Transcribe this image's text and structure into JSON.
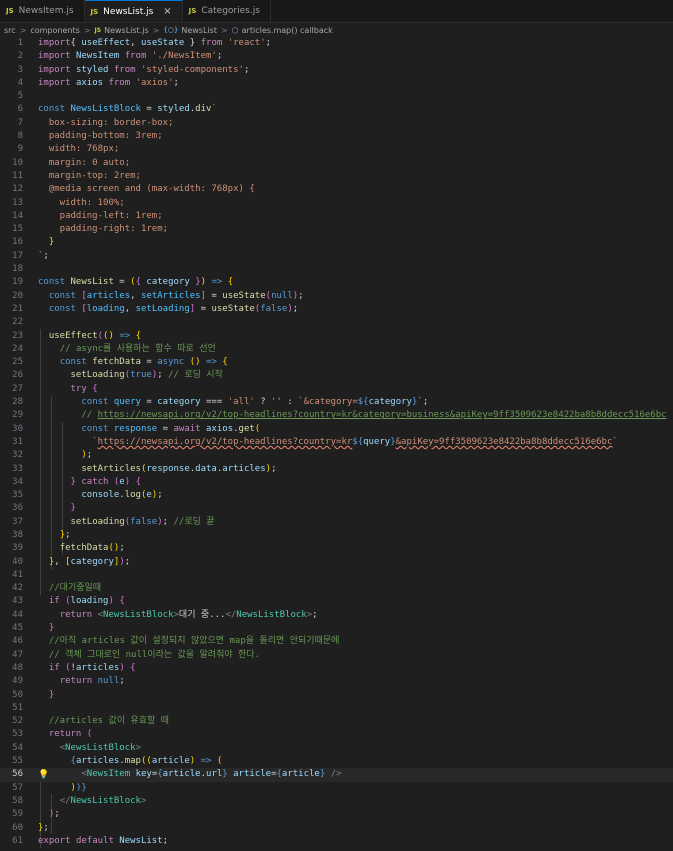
{
  "tabs": [
    {
      "badge": "JS",
      "label": "NewsItem.js",
      "active": false
    },
    {
      "badge": "JS",
      "label": "NewsList.js",
      "active": true,
      "close": "×"
    },
    {
      "badge": "JS",
      "label": "Categories.js",
      "active": false
    }
  ],
  "breadcrumb": {
    "items": [
      "src",
      "components",
      "NewsList.js",
      "NewsList",
      "articles.map() callback"
    ],
    "separator": ">",
    "file_badge": "JS",
    "symbol_glyph": "{○}",
    "function_glyph": "⬡"
  },
  "editor": {
    "current_line": 56,
    "lines": [
      [
        [
          "k",
          "import"
        ],
        [
          "",
          "{ "
        ],
        [
          "v",
          "useEffect"
        ],
        [
          "",
          ", "
        ],
        [
          "v",
          "useState"
        ],
        [
          "",
          " } "
        ],
        [
          "k",
          "from"
        ],
        [
          "",
          " "
        ],
        [
          "s",
          "'react'"
        ],
        [
          "",
          ";"
        ]
      ],
      [
        [
          "k",
          "import"
        ],
        [
          "",
          " "
        ],
        [
          "v",
          "NewsItem"
        ],
        [
          "",
          " "
        ],
        [
          "k",
          "from"
        ],
        [
          "",
          " "
        ],
        [
          "s",
          "'./NewsItem'"
        ],
        [
          "",
          ";"
        ]
      ],
      [
        [
          "k",
          "import"
        ],
        [
          "",
          " "
        ],
        [
          "v",
          "styled"
        ],
        [
          "",
          " "
        ],
        [
          "k",
          "from"
        ],
        [
          "",
          " "
        ],
        [
          "s",
          "'styled-components'"
        ],
        [
          "",
          ";"
        ]
      ],
      [
        [
          "k",
          "import"
        ],
        [
          "",
          " "
        ],
        [
          "v",
          "axios"
        ],
        [
          "",
          " "
        ],
        [
          "k",
          "from"
        ],
        [
          "",
          " "
        ],
        [
          "s",
          "'axios'"
        ],
        [
          "",
          ";"
        ]
      ],
      [],
      [
        [
          "b",
          "const"
        ],
        [
          "",
          " "
        ],
        [
          "c",
          "NewsListBlock"
        ],
        [
          "",
          " = "
        ],
        [
          "v",
          "styled"
        ],
        [
          "",
          "."
        ],
        [
          "f",
          "div"
        ],
        [
          "s",
          "`"
        ]
      ],
      [
        [
          "s",
          "  box-sizing: border-box;"
        ]
      ],
      [
        [
          "s",
          "  padding-bottom: 3rem;"
        ]
      ],
      [
        [
          "s",
          "  width: 768px;"
        ]
      ],
      [
        [
          "s",
          "  margin: 0 auto;"
        ]
      ],
      [
        [
          "s",
          "  margin-top: 2rem;"
        ]
      ],
      [
        [
          "s",
          "  @media screen and (max-width: 768px) {"
        ]
      ],
      [
        [
          "s",
          "    width: 100%;"
        ]
      ],
      [
        [
          "s",
          "    padding-left: 1rem;"
        ]
      ],
      [
        [
          "s",
          "    padding-right: 1rem;"
        ]
      ],
      [
        [
          "s",
          "  "
        ],
        [
          "y",
          "}"
        ]
      ],
      [
        [
          "s",
          "`"
        ],
        [
          "",
          ";"
        ]
      ],
      [],
      [
        [
          "b",
          "const"
        ],
        [
          "",
          " "
        ],
        [
          "f",
          "NewsList"
        ],
        [
          "",
          " = "
        ],
        [
          "y",
          "("
        ],
        [
          "p",
          "{"
        ],
        [
          "",
          " "
        ],
        [
          "v",
          "category"
        ],
        [
          "",
          " "
        ],
        [
          "p",
          "}"
        ],
        [
          "y",
          ")"
        ],
        [
          "",
          " "
        ],
        [
          "b",
          "=>"
        ],
        [
          "",
          " "
        ],
        [
          "y",
          "{"
        ]
      ],
      [
        [
          "",
          "  "
        ],
        [
          "b",
          "const"
        ],
        [
          "",
          " "
        ],
        [
          "p",
          "["
        ],
        [
          "c",
          "articles"
        ],
        [
          "",
          ", "
        ],
        [
          "c",
          "setArticles"
        ],
        [
          "p",
          "]"
        ],
        [
          "",
          " = "
        ],
        [
          "f",
          "useState"
        ],
        [
          "p",
          "("
        ],
        [
          "b",
          "null"
        ],
        [
          "p",
          ")"
        ],
        [
          "",
          ";"
        ]
      ],
      [
        [
          "",
          "  "
        ],
        [
          "b",
          "const"
        ],
        [
          "",
          " "
        ],
        [
          "p",
          "["
        ],
        [
          "c",
          "loading"
        ],
        [
          "",
          ", "
        ],
        [
          "c",
          "setLoading"
        ],
        [
          "p",
          "]"
        ],
        [
          "",
          " = "
        ],
        [
          "f",
          "useState"
        ],
        [
          "p",
          "("
        ],
        [
          "b",
          "false"
        ],
        [
          "p",
          ")"
        ],
        [
          "",
          ";"
        ]
      ],
      [],
      [
        [
          "",
          "  "
        ],
        [
          "f",
          "useEffect"
        ],
        [
          "p",
          "("
        ],
        [
          "y",
          "("
        ],
        [
          "y",
          ")"
        ],
        [
          "",
          " "
        ],
        [
          "b",
          "=>"
        ],
        [
          "",
          " "
        ],
        [
          "y",
          "{"
        ]
      ],
      [
        [
          "",
          "    "
        ],
        [
          "cm",
          "// async를 사용하는 함수 따로 선언"
        ]
      ],
      [
        [
          "",
          "    "
        ],
        [
          "b",
          "const"
        ],
        [
          "",
          " "
        ],
        [
          "f",
          "fetchData"
        ],
        [
          "",
          " = "
        ],
        [
          "b",
          "async"
        ],
        [
          "",
          " "
        ],
        [
          "y",
          "()"
        ],
        [
          "",
          " "
        ],
        [
          "b",
          "=>"
        ],
        [
          "",
          " "
        ],
        [
          "y",
          "{"
        ]
      ],
      [
        [
          "",
          "      "
        ],
        [
          "f",
          "setLoading"
        ],
        [
          "p",
          "("
        ],
        [
          "b",
          "true"
        ],
        [
          "p",
          ")"
        ],
        [
          "",
          ";"
        ],
        [
          "",
          " "
        ],
        [
          "cm",
          "// 로딩 시작"
        ]
      ],
      [
        [
          "",
          "      "
        ],
        [
          "k",
          "try"
        ],
        [
          "",
          " "
        ],
        [
          "p",
          "{"
        ]
      ],
      [
        [
          "",
          "        "
        ],
        [
          "b",
          "const"
        ],
        [
          "",
          " "
        ],
        [
          "c",
          "query"
        ],
        [
          "",
          " = "
        ],
        [
          "v",
          "category"
        ],
        [
          "",
          " === "
        ],
        [
          "s",
          "'all'"
        ],
        [
          "",
          " ? "
        ],
        [
          "s",
          "''"
        ],
        [
          "",
          " : "
        ],
        [
          "s",
          "`&category="
        ],
        [
          "b",
          "${"
        ],
        [
          "v",
          "category"
        ],
        [
          "b",
          "}"
        ],
        [
          "s",
          "`"
        ],
        [
          "",
          ";"
        ]
      ],
      [
        [
          "",
          "        "
        ],
        [
          "cm",
          "// "
        ],
        [
          "cmu",
          "https://newsapi.org/v2/top-headlines?country=kr&category=business&apiKey=9ff3509623e8422ba8b8ddecc516e6bc"
        ]
      ],
      [
        [
          "",
          "        "
        ],
        [
          "b",
          "const"
        ],
        [
          "",
          " "
        ],
        [
          "c",
          "response"
        ],
        [
          "",
          " = "
        ],
        [
          "k",
          "await"
        ],
        [
          "",
          " "
        ],
        [
          "v",
          "axios"
        ],
        [
          "",
          "."
        ],
        [
          "f",
          "get"
        ],
        [
          "y",
          "("
        ]
      ],
      [
        [
          "",
          "          "
        ],
        [
          "s",
          "`"
        ],
        [
          "su",
          "https://newsapi.org/v2/top-headlines?country=kr"
        ],
        [
          "b",
          "${"
        ],
        [
          "v",
          "query"
        ],
        [
          "b",
          "}"
        ],
        [
          "su",
          "&apiKey=9ff3509623e8422ba8b8ddecc516e6bc"
        ],
        [
          "s",
          "`"
        ]
      ],
      [
        [
          "",
          "        "
        ],
        [
          "y",
          ")"
        ],
        [
          "",
          ";"
        ]
      ],
      [
        [
          "",
          "        "
        ],
        [
          "f",
          "setArticles"
        ],
        [
          "y",
          "("
        ],
        [
          "v",
          "response"
        ],
        [
          "",
          "."
        ],
        [
          "v",
          "data"
        ],
        [
          "",
          "."
        ],
        [
          "v",
          "articles"
        ],
        [
          "y",
          ")"
        ],
        [
          "",
          ";"
        ]
      ],
      [
        [
          "",
          "      "
        ],
        [
          "p",
          "}"
        ],
        [
          "",
          " "
        ],
        [
          "k",
          "catch"
        ],
        [
          "",
          " "
        ],
        [
          "p",
          "("
        ],
        [
          "v",
          "e"
        ],
        [
          "p",
          ")"
        ],
        [
          "",
          " "
        ],
        [
          "p",
          "{"
        ]
      ],
      [
        [
          "",
          "        "
        ],
        [
          "v",
          "console"
        ],
        [
          "",
          "."
        ],
        [
          "f",
          "log"
        ],
        [
          "y",
          "("
        ],
        [
          "v",
          "e"
        ],
        [
          "y",
          ")"
        ],
        [
          "",
          ";"
        ]
      ],
      [
        [
          "",
          "      "
        ],
        [
          "p",
          "}"
        ]
      ],
      [
        [
          "",
          "      "
        ],
        [
          "f",
          "setLoading"
        ],
        [
          "p",
          "("
        ],
        [
          "b",
          "false"
        ],
        [
          "p",
          ")"
        ],
        [
          "",
          ";"
        ],
        [
          "",
          " "
        ],
        [
          "cm",
          "//로딩 끝"
        ]
      ],
      [
        [
          "",
          "    "
        ],
        [
          "y",
          "}"
        ],
        [
          "",
          ";"
        ]
      ],
      [
        [
          "",
          "    "
        ],
        [
          "f",
          "fetchData"
        ],
        [
          "y",
          "()"
        ],
        [
          "",
          ";"
        ]
      ],
      [
        [
          "",
          "  "
        ],
        [
          "y",
          "}"
        ],
        [
          "",
          ", "
        ],
        [
          "y",
          "["
        ],
        [
          "v",
          "category"
        ],
        [
          "y",
          "]"
        ],
        [
          "p",
          ")"
        ],
        [
          "",
          ";"
        ]
      ],
      [],
      [
        [
          "",
          "  "
        ],
        [
          "cm",
          "//대기중일때"
        ]
      ],
      [
        [
          "",
          "  "
        ],
        [
          "k",
          "if"
        ],
        [
          "",
          " "
        ],
        [
          "p",
          "("
        ],
        [
          "v",
          "loading"
        ],
        [
          "p",
          ")"
        ],
        [
          "",
          " "
        ],
        [
          "p",
          "{"
        ]
      ],
      [
        [
          "",
          "    "
        ],
        [
          "k",
          "return"
        ],
        [
          "",
          " "
        ],
        [
          "g",
          "<"
        ],
        [
          "t",
          "NewsListBlock"
        ],
        [
          "g",
          ">"
        ],
        [
          "",
          "대기 중..."
        ],
        [
          "g",
          "</"
        ],
        [
          "t",
          "NewsListBlock"
        ],
        [
          "g",
          ">"
        ],
        [
          "",
          ";"
        ]
      ],
      [
        [
          "",
          "  "
        ],
        [
          "p",
          "}"
        ]
      ],
      [
        [
          "",
          "  "
        ],
        [
          "cm",
          "//아직 articles 값이 설정되지 않았으면 map을 돌리면 안되기때문에"
        ]
      ],
      [
        [
          "",
          "  "
        ],
        [
          "cm",
          "// 객체 그대로인 null이라는 값을 알려줘야 한다."
        ]
      ],
      [
        [
          "",
          "  "
        ],
        [
          "k",
          "if"
        ],
        [
          "",
          " "
        ],
        [
          "p",
          "("
        ],
        [
          "",
          "!"
        ],
        [
          "v",
          "articles"
        ],
        [
          "p",
          ")"
        ],
        [
          "",
          " "
        ],
        [
          "p",
          "{"
        ]
      ],
      [
        [
          "",
          "    "
        ],
        [
          "k",
          "return"
        ],
        [
          "",
          " "
        ],
        [
          "b",
          "null"
        ],
        [
          "",
          ";"
        ]
      ],
      [
        [
          "",
          "  "
        ],
        [
          "p",
          "}"
        ]
      ],
      [],
      [
        [
          "",
          "  "
        ],
        [
          "cm",
          "//articles 값이 유효할 때"
        ]
      ],
      [
        [
          "",
          "  "
        ],
        [
          "k",
          "return"
        ],
        [
          "",
          " "
        ],
        [
          "p",
          "("
        ]
      ],
      [
        [
          "",
          "    "
        ],
        [
          "g",
          "<"
        ],
        [
          "t",
          "NewsListBlock"
        ],
        [
          "g",
          ">"
        ]
      ],
      [
        [
          "",
          "      "
        ],
        [
          "b",
          "{"
        ],
        [
          "v",
          "articles"
        ],
        [
          "",
          "."
        ],
        [
          "f",
          "map"
        ],
        [
          "y",
          "("
        ],
        [
          "y",
          "("
        ],
        [
          "v",
          "article"
        ],
        [
          "y",
          ")"
        ],
        [
          "",
          " "
        ],
        [
          "b",
          "=>"
        ],
        [
          "",
          " "
        ],
        [
          "y",
          "("
        ]
      ],
      [
        [
          "",
          "        "
        ],
        [
          "g",
          "<"
        ],
        [
          "t",
          "NewsItem"
        ],
        [
          "",
          " "
        ],
        [
          "v",
          "key"
        ],
        [
          "",
          "="
        ],
        [
          "b",
          "{"
        ],
        [
          "v",
          "article"
        ],
        [
          "",
          "."
        ],
        [
          "v",
          "url"
        ],
        [
          "b",
          "}"
        ],
        [
          "",
          " "
        ],
        [
          "v",
          "article"
        ],
        [
          "",
          "="
        ],
        [
          "b",
          "{"
        ],
        [
          "v",
          "article"
        ],
        [
          "b",
          "}"
        ],
        [
          "",
          " "
        ],
        [
          "g",
          "/>"
        ]
      ],
      [
        [
          "",
          "      "
        ],
        [
          "y",
          ")"
        ],
        [
          "b",
          ")}"
        ]
      ],
      [
        [
          "",
          "    "
        ],
        [
          "g",
          "</"
        ],
        [
          "t",
          "NewsListBlock"
        ],
        [
          "g",
          ">"
        ]
      ],
      [
        [
          "",
          "  "
        ],
        [
          "p",
          ")"
        ],
        [
          "",
          ";"
        ]
      ],
      [
        [
          "y",
          "}"
        ],
        [
          "",
          ";"
        ]
      ],
      [
        [
          "k",
          "export"
        ],
        [
          "",
          " "
        ],
        [
          "k",
          "default"
        ],
        [
          "",
          " "
        ],
        [
          "v",
          "NewsList"
        ],
        [
          "",
          ";"
        ]
      ]
    ]
  }
}
